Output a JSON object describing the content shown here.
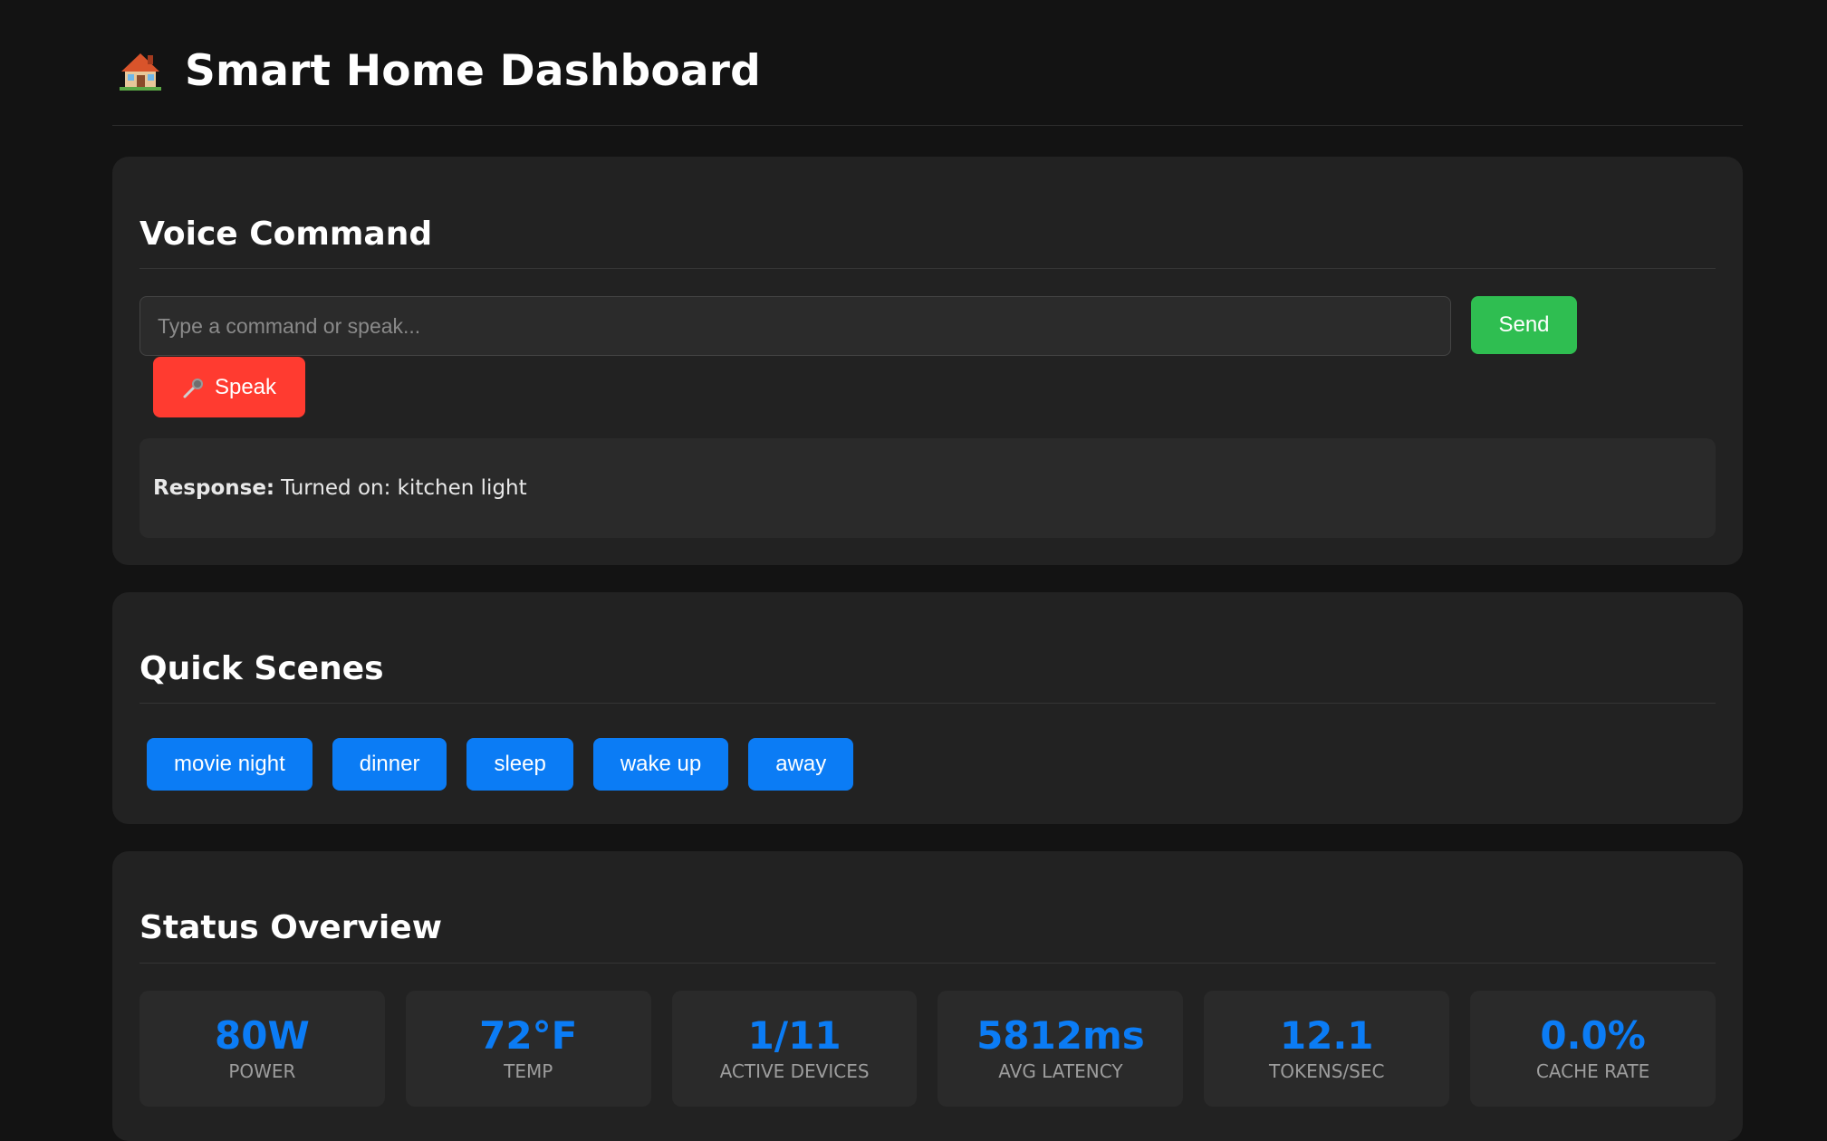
{
  "header": {
    "icon": "house-icon",
    "title": "Smart Home Dashboard"
  },
  "voice_command": {
    "title": "Voice Command",
    "input_placeholder": "Type a command or speak...",
    "input_value": "",
    "send_label": "Send",
    "speak_label": "Speak",
    "speak_icon": "microphone-icon",
    "response_label": "Response:",
    "response_text": "Turned on: kitchen light"
  },
  "quick_scenes": {
    "title": "Quick Scenes",
    "scenes": [
      "movie night",
      "dinner",
      "sleep",
      "wake up",
      "away"
    ]
  },
  "status_overview": {
    "title": "Status Overview",
    "stats": [
      {
        "value": "80W",
        "label": "POWER"
      },
      {
        "value": "72°F",
        "label": "TEMP"
      },
      {
        "value": "1/11",
        "label": "ACTIVE DEVICES"
      },
      {
        "value": "5812ms",
        "label": "AVG LATENCY"
      },
      {
        "value": "12.1",
        "label": "TOKENS/SEC"
      },
      {
        "value": "0.0%",
        "label": "CACHE RATE"
      }
    ]
  },
  "colors": {
    "background": "#131313",
    "card": "#222222",
    "accent_blue": "#0b7cf5",
    "send_green": "#2fbe51",
    "speak_red": "#ff3b30"
  }
}
